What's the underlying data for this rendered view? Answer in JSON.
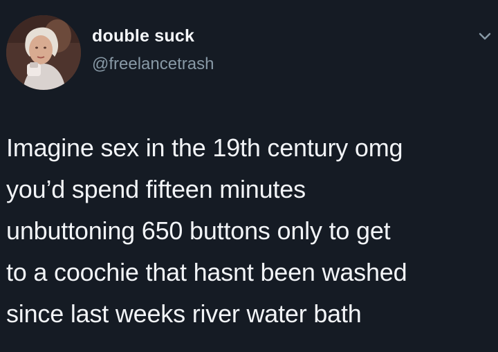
{
  "author": {
    "display_name": "double suck",
    "handle": "@freelancetrash",
    "avatar_icon": "profile-photo"
  },
  "tweet": {
    "lines": [
      "Imagine sex in the 19th century omg",
      "you’d spend fifteen minutes",
      "unbuttoning 650 buttons only to get",
      "to a coochie that hasnt been washed",
      "since last weeks river water bath"
    ]
  },
  "menu": {
    "icon": "chevron-down-icon"
  },
  "colors": {
    "background": "#151b24",
    "text": "#f2f4f7",
    "secondary_text": "#8899a6"
  }
}
